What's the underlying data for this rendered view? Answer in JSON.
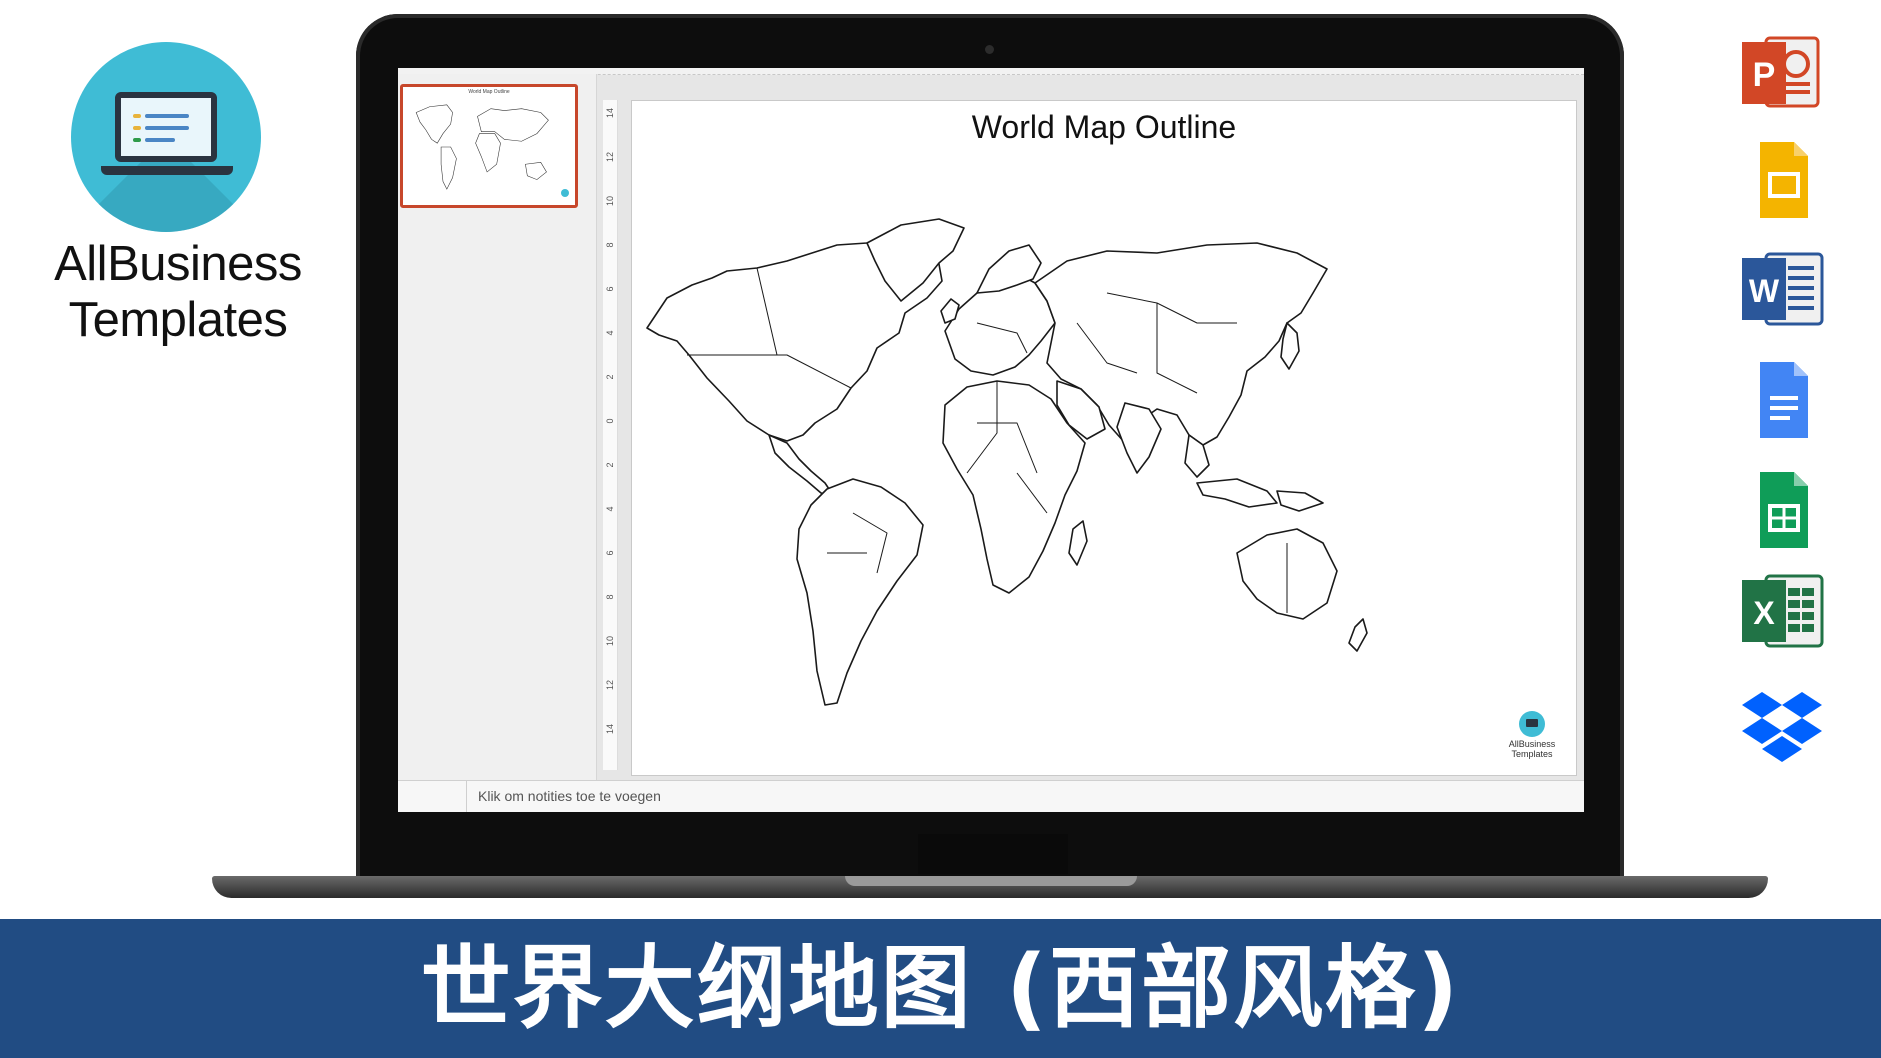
{
  "brand": {
    "name_line1": "AllBusiness",
    "name_line2": "Templates",
    "logo_icon": "laptop-icon"
  },
  "app": {
    "slide_title": "World Map Outline",
    "slide_logo_line1": "AllBusiness",
    "slide_logo_line2": "Templates",
    "thumbnail_title": "World Map Outline",
    "notes_placeholder": "Klik om notities toe te voegen",
    "ruler_ticks": [
      "14",
      "12",
      "10",
      "8",
      "6",
      "4",
      "2",
      "0",
      "2",
      "4",
      "6",
      "8",
      "10",
      "12",
      "14"
    ]
  },
  "side_icons": [
    {
      "name": "powerpoint-icon",
      "color": "#d24726",
      "label": "P"
    },
    {
      "name": "google-slides-icon",
      "color": "#f4b400",
      "label": ""
    },
    {
      "name": "word-icon",
      "color": "#2b579a",
      "label": "W"
    },
    {
      "name": "google-docs-icon",
      "color": "#4285f4",
      "label": ""
    },
    {
      "name": "google-sheets-icon",
      "color": "#0f9d58",
      "label": ""
    },
    {
      "name": "excel-icon",
      "color": "#217346",
      "label": "X"
    },
    {
      "name": "dropbox-icon",
      "color": "#0061fe",
      "label": ""
    }
  ],
  "banner": {
    "title": "世界大纲地图 (西部风格)",
    "color": "#214c83"
  }
}
